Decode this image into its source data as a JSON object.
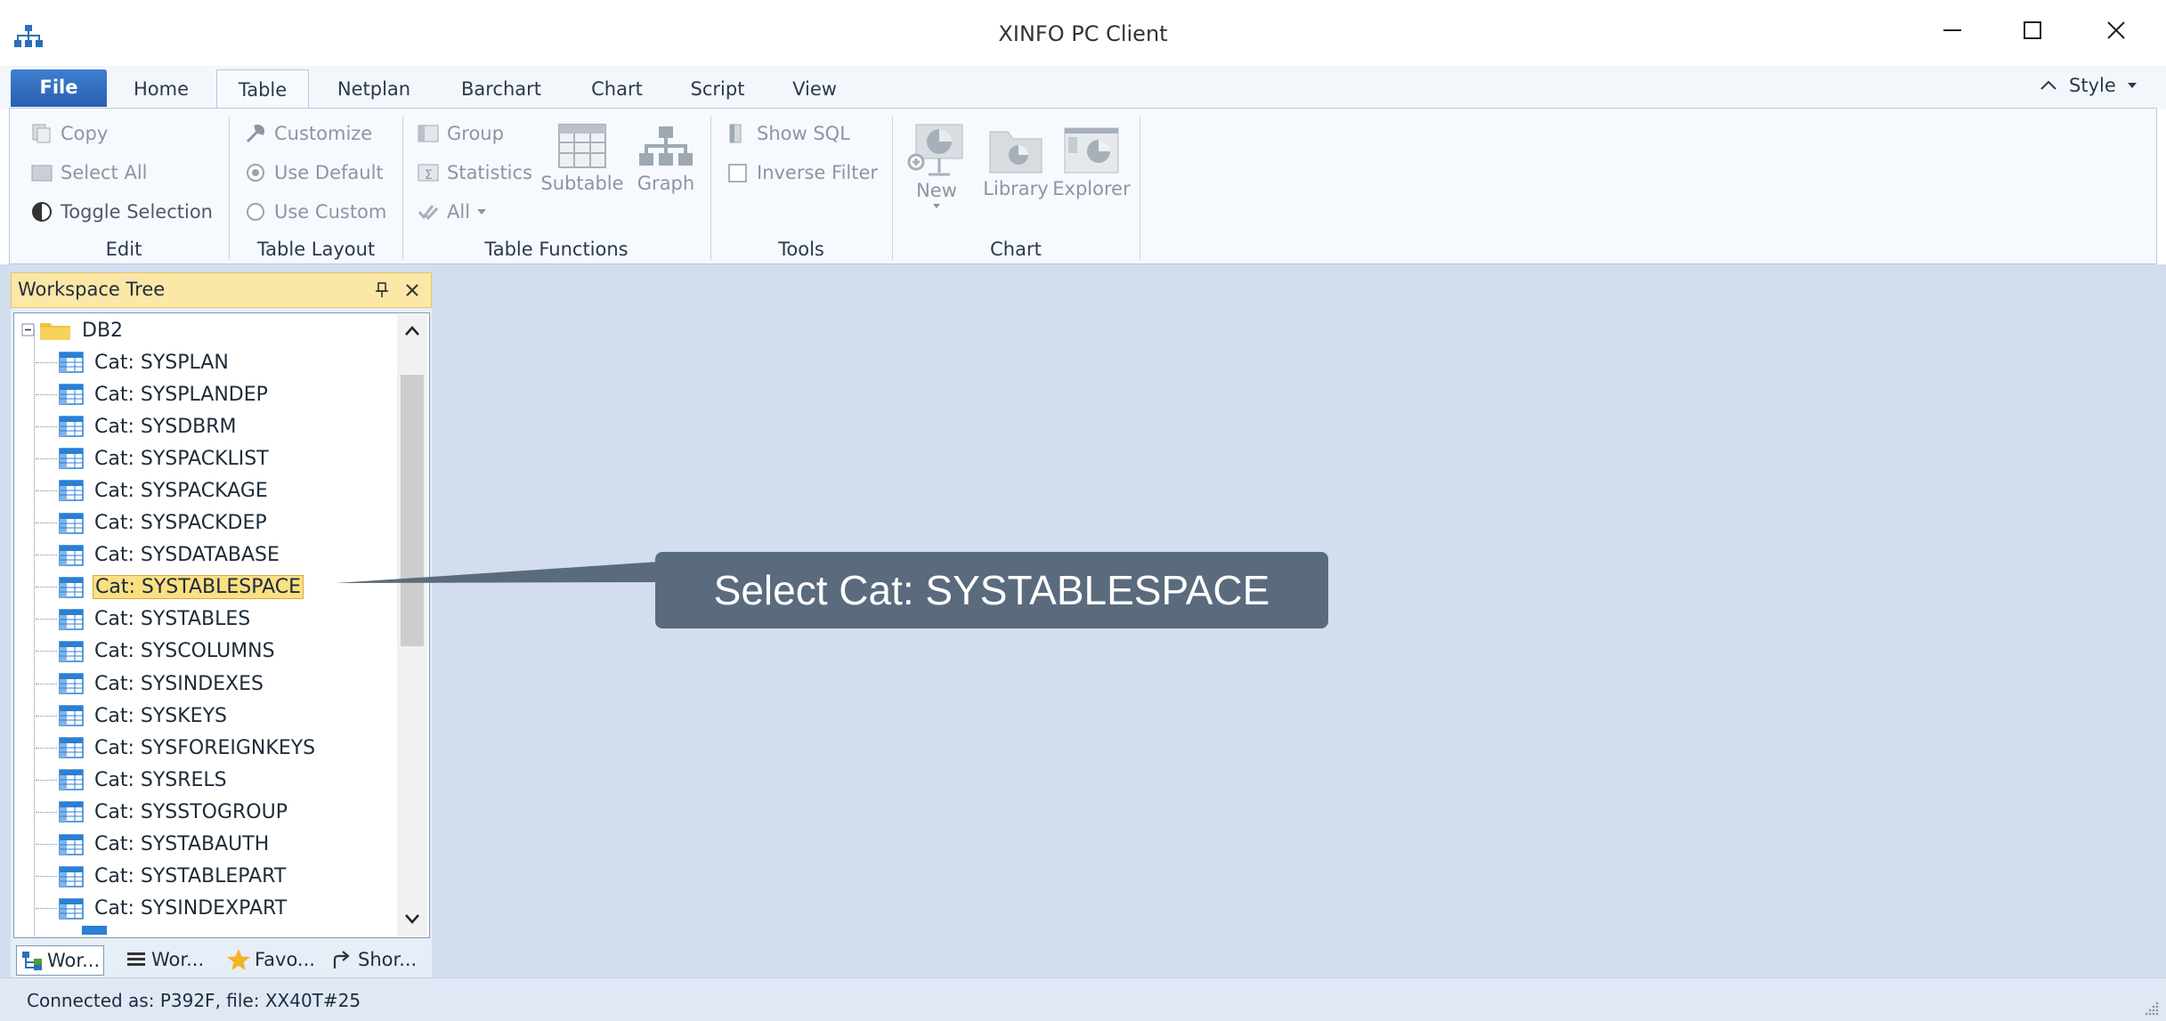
{
  "window": {
    "title": "XINFO PC Client"
  },
  "ribbon_tabs": [
    "File",
    "Home",
    "Table",
    "Netplan",
    "Barchart",
    "Chart",
    "Script",
    "View"
  ],
  "style_label": "Style",
  "ribbon": {
    "edit": {
      "copy": "Copy",
      "select_all": "Select All",
      "toggle_selection": "Toggle Selection",
      "label": "Edit"
    },
    "table_layout": {
      "customize": "Customize",
      "use_default": "Use Default",
      "use_custom": "Use Custom",
      "label": "Table Layout"
    },
    "table_functions": {
      "group": "Group",
      "statistics": "Statistics",
      "all": "All",
      "subtable": "Subtable",
      "graph": "Graph",
      "label": "Table Functions"
    },
    "tools": {
      "show_sql": "Show SQL",
      "inverse_filter": "Inverse Filter",
      "label": "Tools"
    },
    "chart": {
      "new": "New",
      "library": "Library",
      "explorer": "Explorer",
      "label": "Chart"
    }
  },
  "workspace_tree": {
    "title": "Workspace Tree",
    "root": "DB2",
    "items": [
      "Cat: SYSPLAN",
      "Cat: SYSPLANDEP",
      "Cat: SYSDBRM",
      "Cat: SYSPACKLIST",
      "Cat: SYSPACKAGE",
      "Cat: SYSPACKDEP",
      "Cat: SYSDATABASE",
      "Cat: SYSTABLESPACE",
      "Cat: SYSTABLES",
      "Cat: SYSCOLUMNS",
      "Cat: SYSINDEXES",
      "Cat: SYSKEYS",
      "Cat: SYSFOREIGNKEYS",
      "Cat: SYSRELS",
      "Cat: SYSSTOGROUP",
      "Cat: SYSTABAUTH",
      "Cat: SYSTABLEPART",
      "Cat: SYSINDEXPART"
    ],
    "selected": "Cat: SYSTABLESPACE"
  },
  "panel_tabs": [
    "Wor...",
    "Wor...",
    "Favo...",
    "Shor..."
  ],
  "status": "Connected as: P392F, file: XX40T#25",
  "callout": "Select Cat: SYSTABLESPACE",
  "colors": {
    "accent": "#2a5fb0",
    "selection": "#fbdf83",
    "callout_bg": "#596b7c",
    "workspace_bg": "#d2dded"
  }
}
